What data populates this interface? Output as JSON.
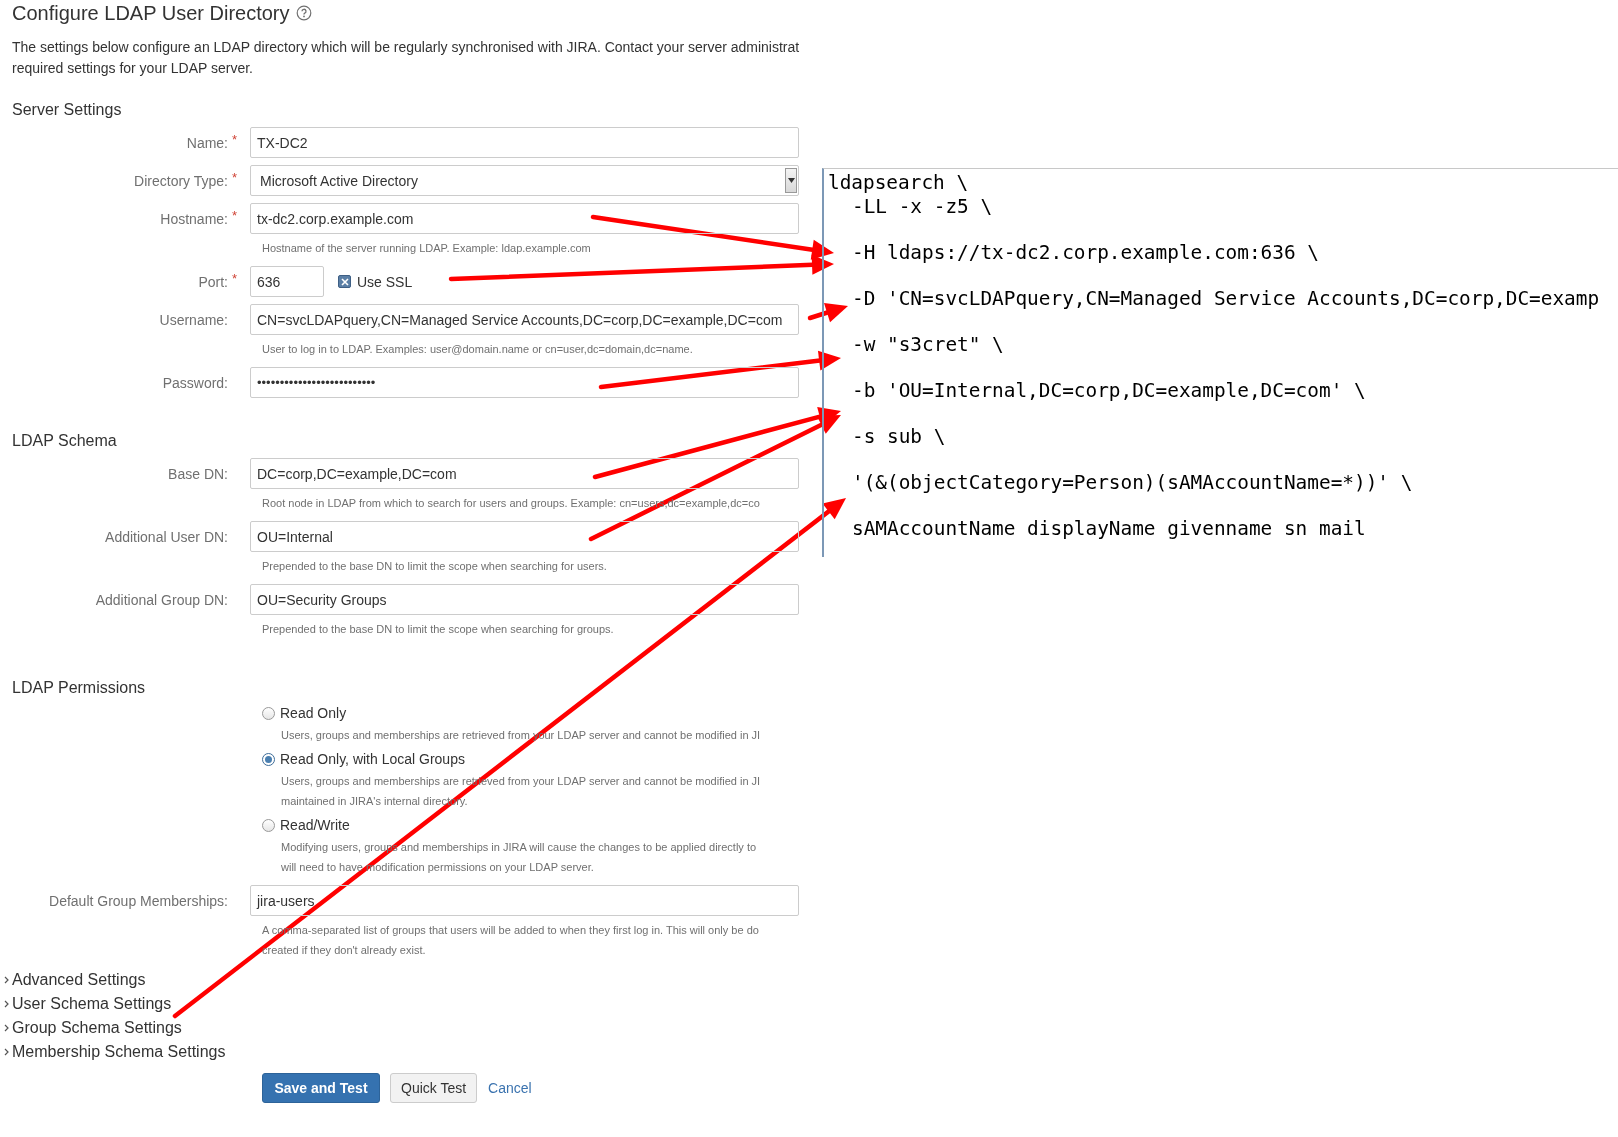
{
  "page": {
    "title": "Configure LDAP User Directory",
    "description_lines": [
      "The settings below configure an LDAP directory which will be regularly synchronised with JIRA. Contact your server administrat",
      "required settings for your LDAP server."
    ]
  },
  "sections": [
    {
      "heading": "Server Settings",
      "fields": [
        {
          "label": "Name:$^{*}$",
          "kind": "text",
          "value": "TX-DC2"
        },
        {
          "label": "Directory Type:$^{*}$",
          "kind": "select",
          "value": "Microsoft Active Directory"
        },
        {
          "label": "Hostname:$^{*}$",
          "kind": "text",
          "value": "tx-dc2.corp.example.com",
          "hint_lines": [
            "Hostname of the server running LDAP. Example: ldap.example.com"
          ]
        },
        {
          "label": "Port:$^{*}$",
          "kind": "port",
          "value": "636",
          "checkbox": {
            "label": "Use SSL",
            "checked": true
          }
        },
        {
          "label": "Username:",
          "kind": "text",
          "value": "CN=svcLDAPquery,CN=Managed Service Accounts,DC=corp,DC=example,DC=com",
          "hint_lines": [
            "User to log in to LDAP. Examples: user@domain.name or cn=user,dc=domain,dc=name."
          ]
        },
        {
          "label": "Password:",
          "kind": "password",
          "value": "••••••••••••••••••••••••••"
        }
      ]
    },
    {
      "heading": "LDAP Schema",
      "fields": [
        {
          "label": "Base DN:",
          "kind": "text",
          "value": "DC=corp,DC=example,DC=com",
          "hint_lines": [
            "Root node in LDAP from which to search for users and groups. Example: cn=users,dc=example,dc=co"
          ]
        },
        {
          "label": "Additional User DN:",
          "kind": "text",
          "value": "OU=Internal",
          "hint_lines": [
            "Prepended to the base DN to limit the scope when searching for users."
          ]
        },
        {
          "label": "Additional Group DN:",
          "kind": "text",
          "value": "OU=Security Groups",
          "hint_lines": [
            "Prepended to the base DN to limit the scope when searching for groups."
          ]
        }
      ]
    }
  ],
  "permissions": {
    "heading": "LDAP Permissions",
    "options": [
      {
        "label": "Read Only",
        "selected": false,
        "description_lines": [
          "Users, groups and memberships are retrieved from your LDAP server and cannot be modified in JI"
        ]
      },
      {
        "label": "Read Only, with Local Groups",
        "selected": true,
        "description_lines": [
          "Users, groups and memberships are retrieved from your LDAP server and cannot be modified in JI",
          "maintained in JIRA's internal directory."
        ]
      },
      {
        "label": "Read/Write",
        "selected": false,
        "description_lines": [
          "Modifying users, groups and memberships in JIRA will cause the changes to be applied directly to",
          "will need to have modification permissions on your LDAP server."
        ]
      }
    ]
  },
  "default_group": {
    "label": "Default Group Memberships:",
    "value": "jira-users",
    "hint_lines": [
      "A comma-separated list of groups that users will be added to when they first log in. This will only be do",
      "created if they don't already exist."
    ]
  },
  "expanders": [
    "Advanced Settings",
    "User Schema Settings",
    "Group Schema Settings",
    "Membership Schema Settings"
  ],
  "buttons": {
    "save": "Save and Test",
    "quick_test": "Quick Test",
    "cancel": "Cancel"
  },
  "terminal": {
    "lines": [
      {
        "text": "ldapsearch \\",
        "indented": false
      },
      {
        "text": "-LL -x -z5 \\",
        "indented": true
      },
      {
        "text": "-H ldaps://tx-dc2.corp.example.com:636 \\",
        "indented": true
      },
      {
        "text": "-D 'CN=svcLDAPquery,CN=Managed Service Accounts,DC=corp,DC=examp",
        "indented": true
      },
      {
        "text": "-w \"s3cret\" \\",
        "indented": true
      },
      {
        "text": "-b 'OU=Internal,DC=corp,DC=example,DC=com' \\",
        "indented": true
      },
      {
        "text": "-s sub \\",
        "indented": true
      },
      {
        "text": "'(&(objectCategory=Person)(sAMAccountName=*))' \\",
        "indented": true
      },
      {
        "text": "sAMAccountName displayName givenname sn mail",
        "indented": true
      }
    ]
  }
}
